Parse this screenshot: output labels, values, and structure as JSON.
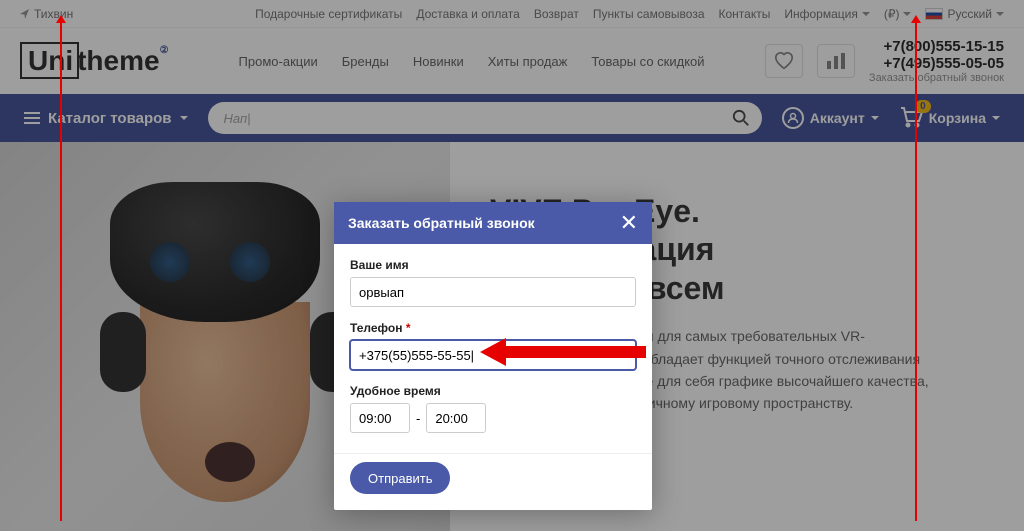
{
  "topbar": {
    "location": "Тихвин",
    "links": {
      "gift": "Подарочные сертификаты",
      "delivery": "Доставка и оплата",
      "returns": "Возврат",
      "pickup": "Пункты самовывоза",
      "contacts": "Контакты",
      "info": "Информация"
    },
    "currency": "(₽)",
    "language": "Русский"
  },
  "header": {
    "logo_pre": "Uni",
    "logo_post": "theme",
    "nav": {
      "promo": "Промо-акции",
      "brands": "Бренды",
      "new": "Новинки",
      "hits": "Хиты продаж",
      "sale": "Товары со скидкой"
    },
    "phone1": "+7(800)555-15-15",
    "phone2": "+7(495)555-05-05",
    "callback": "Заказать обратный звонок"
  },
  "bluebar": {
    "catalog": "Каталог товаров",
    "search_value": "Нап|",
    "account": "Аккаунт",
    "cart": "Корзина",
    "cart_count": "0"
  },
  "hero": {
    "title_l1": "VIVE Pro Eye.",
    "title_l2": "Визуализация",
    "title_l3": "доступна всем",
    "desc": "VIVE Pro Eye, созданный для самых требовательных VR-пользователей, теперь обладает функцией точного отслеживания движения глаз. Откройте для себя графике высочайшего качества, хай-энд аудио и безграничному игровому пространству."
  },
  "modal": {
    "title": "Заказать обратный звонок",
    "name_label": "Ваше имя",
    "name_value": "орвыап",
    "phone_label": "Телефон",
    "phone_value": "+375(55)555-55-55|",
    "time_label": "Удобное время",
    "time_from": "09:00",
    "time_sep": "-",
    "time_to": "20:00",
    "submit": "Отправить"
  }
}
